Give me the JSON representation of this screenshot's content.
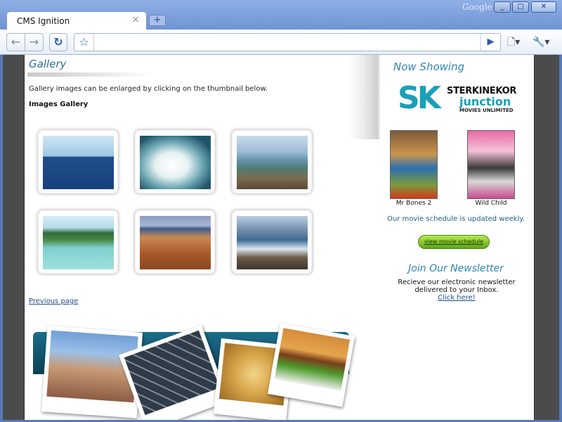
{
  "browser": {
    "brand": "Google",
    "tab_title": "CMS Ignition",
    "tab_close": "×",
    "new_tab": "+",
    "address": "",
    "controls": {
      "minimize": "_",
      "maximize": "□",
      "close": "✕"
    },
    "icons": {
      "back": "←",
      "forward": "→",
      "reload": "↻",
      "star": "☆",
      "go": "▶",
      "page_menu": "🗋▾",
      "wrench_menu": "🔧▾"
    }
  },
  "gallery": {
    "title": "Gallery",
    "intro": "Gallery images can be enlarged by clicking on the thumbnail below.",
    "heading": "Images Gallery",
    "thumbnails": [
      {
        "subject": "ocean-swimmers"
      },
      {
        "subject": "crashing-wave"
      },
      {
        "subject": "tidal-pool"
      },
      {
        "subject": "lagoon-palms"
      },
      {
        "subject": "sandy-beach"
      },
      {
        "subject": "rocky-coast"
      }
    ],
    "previous_link": "Previous page"
  },
  "sidebar": {
    "now_showing": "Now Showing",
    "logo": {
      "mark": "SK",
      "line1": "STERKINEKOR",
      "line2": "junction",
      "line3": "MOVIES UNLIMITED"
    },
    "movies": [
      {
        "title": "Mr Bones 2"
      },
      {
        "title": "Wild Child"
      }
    ],
    "schedule_text": "Our movie schedule is updated weekly.",
    "schedule_button": "view movie schedule",
    "newsletter_title": "Join Our Newsletter",
    "newsletter_text": "Recieve our electronic newsletter delivered to your Inbox.",
    "newsletter_link": "Click here!"
  }
}
